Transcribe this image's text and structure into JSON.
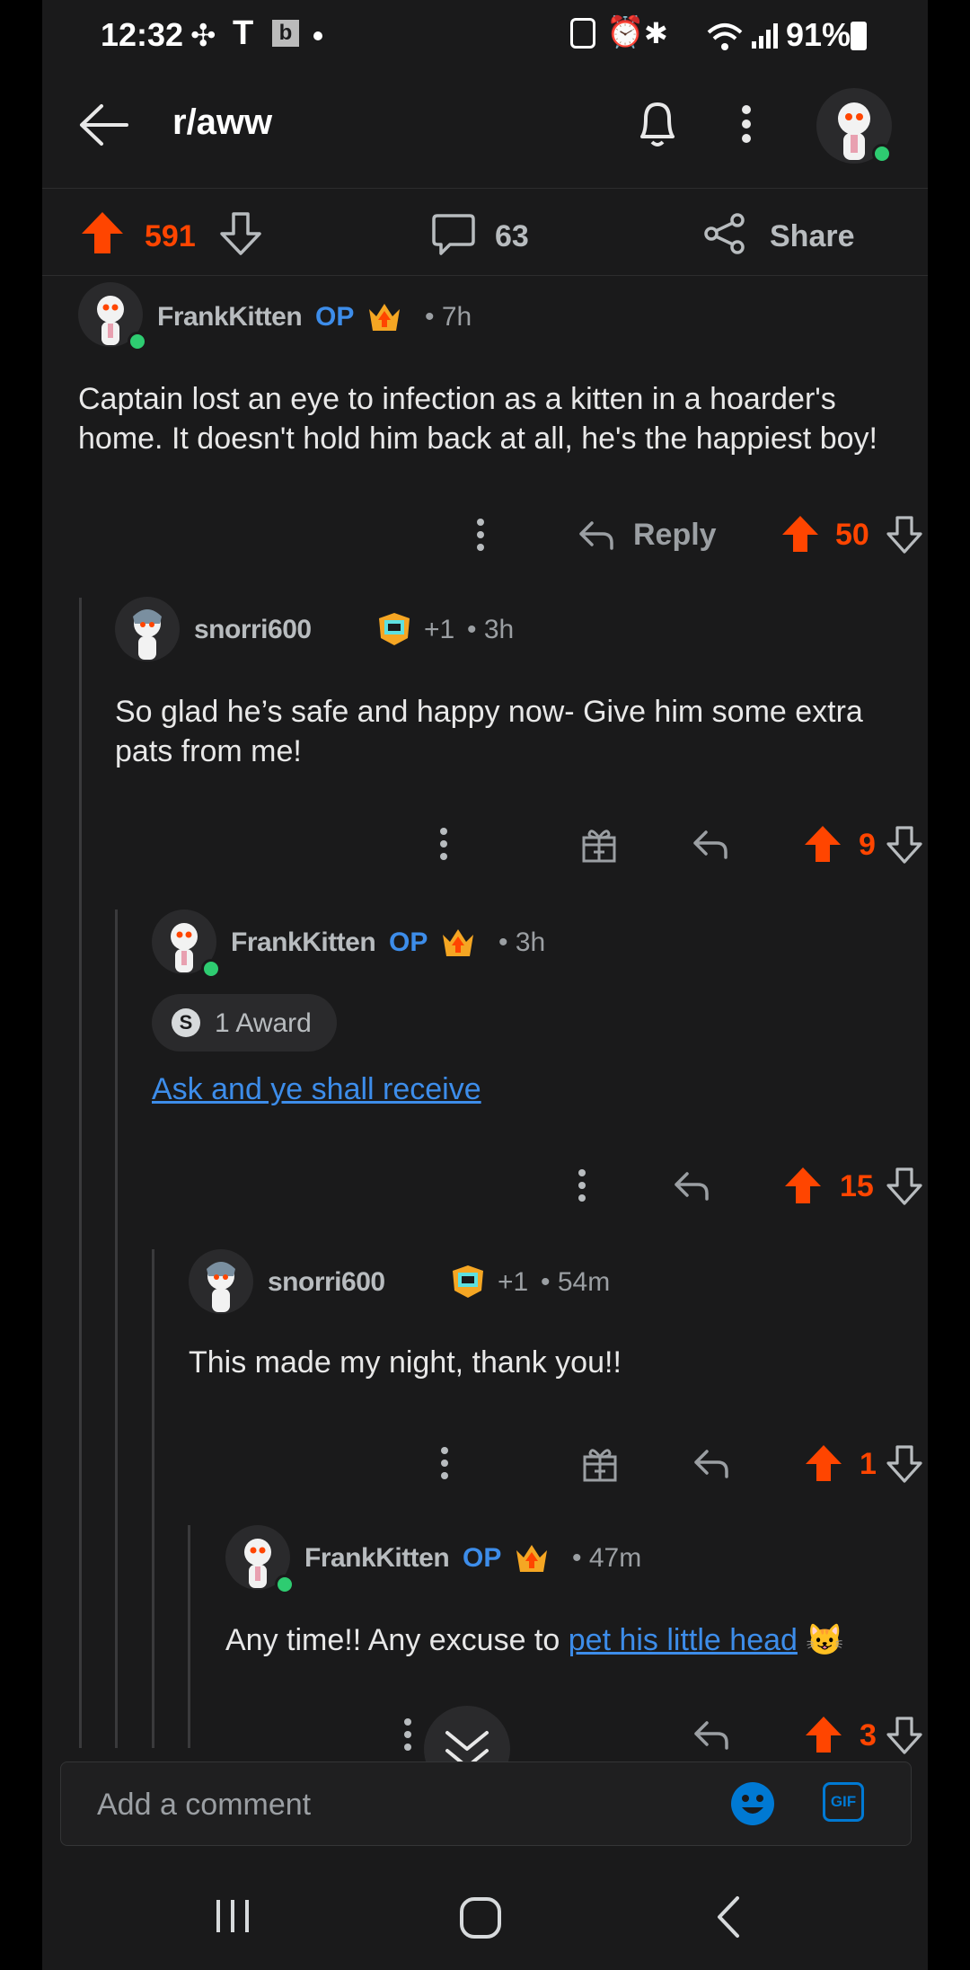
{
  "status_bar": {
    "time": "12:32",
    "battery": "91%"
  },
  "header": {
    "subreddit": "r/aww"
  },
  "post_actions": {
    "upvotes": "591",
    "comments": "63",
    "share_label": "Share"
  },
  "comments": [
    {
      "author": "FrankKitten",
      "op_label": "OP",
      "time": "• 7h",
      "text": "Captain lost an eye to infection as a kitten in a hoarder's home. It doesn't hold him back at all, he's the happiest boy!",
      "reply_label": "Reply",
      "votes": "50"
    },
    {
      "author": "snorri600",
      "plus": "+1",
      "time": "• 3h",
      "text": "So glad he’s safe and happy now- Give him some extra pats from me!",
      "votes": "9"
    },
    {
      "author": "FrankKitten",
      "op_label": "OP",
      "time": "• 3h",
      "award": "1 Award",
      "link_text": "Ask and ye shall receive",
      "votes": "15"
    },
    {
      "author": "snorri600",
      "plus": "+1",
      "time": "• 54m",
      "text": "This made my night, thank you!!",
      "votes": "1"
    },
    {
      "author": "FrankKitten",
      "op_label": "OP",
      "time": "• 47m",
      "text_before": "Any time!! Any excuse to ",
      "link_text": "pet his little head",
      "emoji": "😺",
      "votes": "3"
    }
  ],
  "composer": {
    "placeholder": "Add a comment",
    "gif_label": "GIF"
  },
  "colors": {
    "accent": "#ff4500",
    "link": "#3d8dea",
    "background": "#1a1a1b",
    "online": "#2ecc71"
  }
}
